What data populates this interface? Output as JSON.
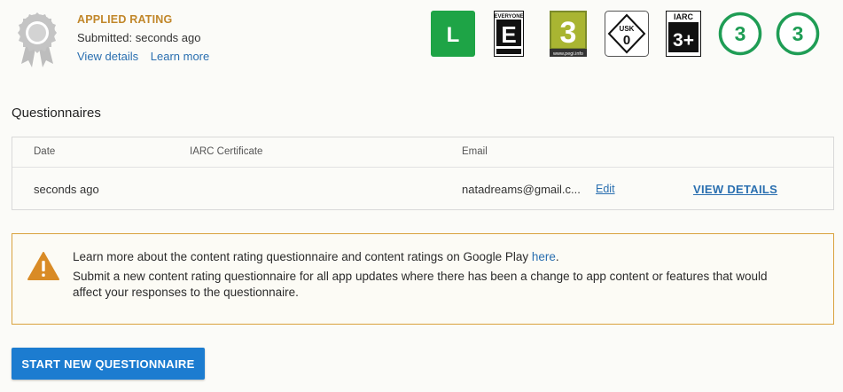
{
  "rating": {
    "title": "APPLIED RATING",
    "submitted": "Submitted: seconds ago",
    "view_details": "View details",
    "learn_more": "Learn more"
  },
  "badges": [
    {
      "name": "classind",
      "text": "L"
    },
    {
      "name": "esrb",
      "text": "E",
      "top": "EVERYONE"
    },
    {
      "name": "pegi",
      "text": "3",
      "bottom": "www.pegi.info"
    },
    {
      "name": "usk",
      "text": "0",
      "top": "USK"
    },
    {
      "name": "iarc",
      "text": "3+",
      "top": "IARC"
    },
    {
      "name": "generic-3-a",
      "text": "3"
    },
    {
      "name": "generic-3-b",
      "text": "3"
    }
  ],
  "questionnaires": {
    "title": "Questionnaires",
    "columns": [
      "Date",
      "IARC Certificate",
      "Email"
    ],
    "rows": [
      {
        "date": "seconds ago",
        "email": "natadreams@gmail.c...",
        "edit": "Edit",
        "view": "VIEW DETAILS"
      }
    ]
  },
  "notice": {
    "line1": "Learn more about the content rating questionnaire and content ratings on Google Play ",
    "line1_link": "here",
    "line1_end": ".",
    "line2": "Submit a new content rating questionnaire for all app updates where there has been a change to app content or features that would affect your responses to the questionnaire."
  },
  "actions": {
    "start": "START NEW QUESTIONNAIRE"
  }
}
